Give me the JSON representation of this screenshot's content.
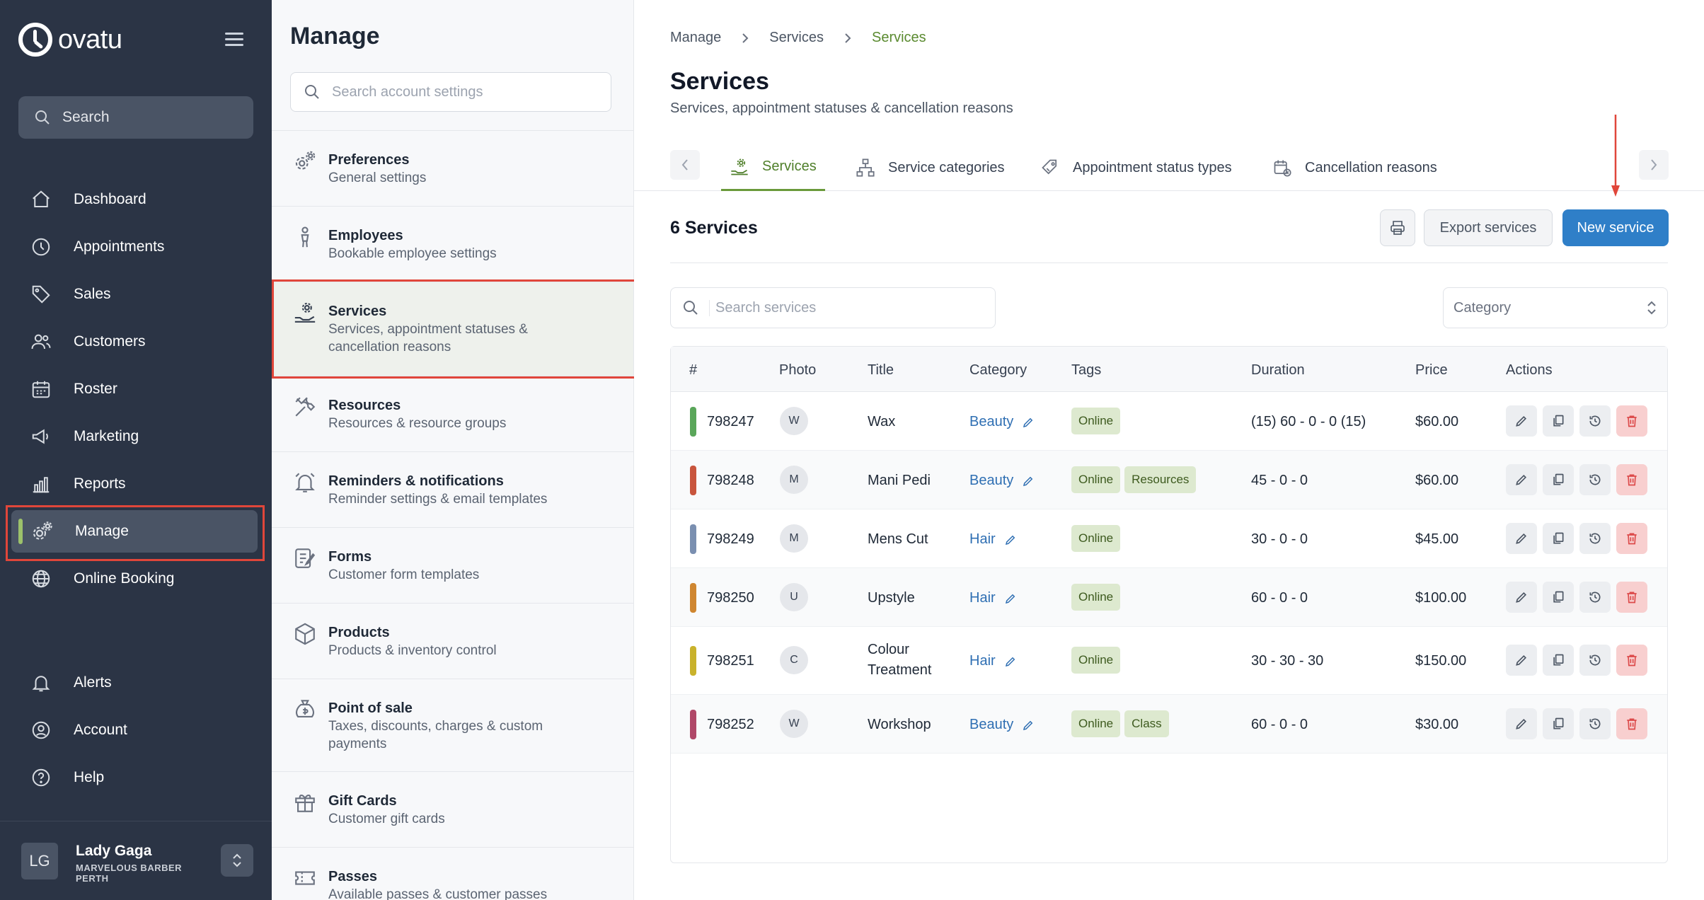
{
  "nav": {
    "brand": "ovatu",
    "search_label": "Search",
    "items": [
      {
        "label": "Dashboard",
        "icon": "home-icon"
      },
      {
        "label": "Appointments",
        "icon": "clock-icon"
      },
      {
        "label": "Sales",
        "icon": "tag-icon"
      },
      {
        "label": "Customers",
        "icon": "users-icon"
      },
      {
        "label": "Roster",
        "icon": "calendar-icon"
      },
      {
        "label": "Marketing",
        "icon": "megaphone-icon"
      },
      {
        "label": "Reports",
        "icon": "chart-icon"
      },
      {
        "label": "Manage",
        "icon": "gears-icon"
      },
      {
        "label": "Online Booking",
        "icon": "globe-icon"
      },
      {
        "label": "Alerts",
        "icon": "bell-icon"
      },
      {
        "label": "Account",
        "icon": "account-icon"
      },
      {
        "label": "Help",
        "icon": "help-icon"
      }
    ],
    "user": {
      "initials": "LG",
      "name": "Lady Gaga",
      "business": "MARVELOUS BARBER PERTH"
    }
  },
  "manage": {
    "title": "Manage",
    "search_placeholder": "Search account settings",
    "items": [
      {
        "title": "Preferences",
        "sub": "General settings"
      },
      {
        "title": "Employees",
        "sub": "Bookable employee settings"
      },
      {
        "title": "Services",
        "sub": "Services, appointment statuses & cancellation reasons"
      },
      {
        "title": "Resources",
        "sub": "Resources & resource groups"
      },
      {
        "title": "Reminders & notifications",
        "sub": "Reminder settings & email templates"
      },
      {
        "title": "Forms",
        "sub": "Customer form templates"
      },
      {
        "title": "Products",
        "sub": "Products & inventory control"
      },
      {
        "title": "Point of sale",
        "sub": "Taxes, discounts, charges & custom payments"
      },
      {
        "title": "Gift Cards",
        "sub": "Customer gift cards"
      },
      {
        "title": "Passes",
        "sub": "Available passes & customer passes"
      }
    ]
  },
  "main": {
    "breadcrumb": [
      "Manage",
      "Services",
      "Services"
    ],
    "title": "Services",
    "subtitle": "Services, appointment statuses & cancellation reasons",
    "tabs": [
      {
        "label": "Services"
      },
      {
        "label": "Service categories"
      },
      {
        "label": "Appointment status types"
      },
      {
        "label": "Cancellation reasons"
      }
    ],
    "count_title": "6 Services",
    "export_label": "Export services",
    "new_label": "New service",
    "search_placeholder": "Search services",
    "category_placeholder": "Category",
    "columns": [
      "#",
      "Photo",
      "Title",
      "Category",
      "Tags",
      "Duration",
      "Price",
      "Actions"
    ],
    "rows": [
      {
        "id": "798247",
        "photo": "W",
        "title": "Wax",
        "category": "Beauty",
        "tags": [
          "Online"
        ],
        "duration": "(15) 60 - 0 - 0 (15)",
        "price": "$60.00",
        "color": "#5aa65a"
      },
      {
        "id": "798248",
        "photo": "M",
        "title": "Mani Pedi",
        "category": "Beauty",
        "tags": [
          "Online",
          "Resources"
        ],
        "duration": "45 - 0 - 0",
        "price": "$60.00",
        "color": "#c8553d"
      },
      {
        "id": "798249",
        "photo": "M",
        "title": "Mens Cut",
        "category": "Hair",
        "tags": [
          "Online"
        ],
        "duration": "30 - 0 - 0",
        "price": "$45.00",
        "color": "#7a8fb0"
      },
      {
        "id": "798250",
        "photo": "U",
        "title": "Upstyle",
        "category": "Hair",
        "tags": [
          "Online"
        ],
        "duration": "60 - 0 - 0",
        "price": "$100.00",
        "color": "#cf8630"
      },
      {
        "id": "798251",
        "photo": "C",
        "title_line1": "Colour",
        "title_line2": "Treatment",
        "category": "Hair",
        "tags": [
          "Online"
        ],
        "duration": "30 - 30 - 30",
        "price": "$150.00",
        "color": "#c9b22c"
      },
      {
        "id": "798252",
        "photo": "W",
        "title": "Workshop",
        "category": "Beauty",
        "tags": [
          "Online",
          "Class"
        ],
        "duration": "60 - 0 - 0",
        "price": "$30.00",
        "color": "#b04868"
      }
    ]
  }
}
